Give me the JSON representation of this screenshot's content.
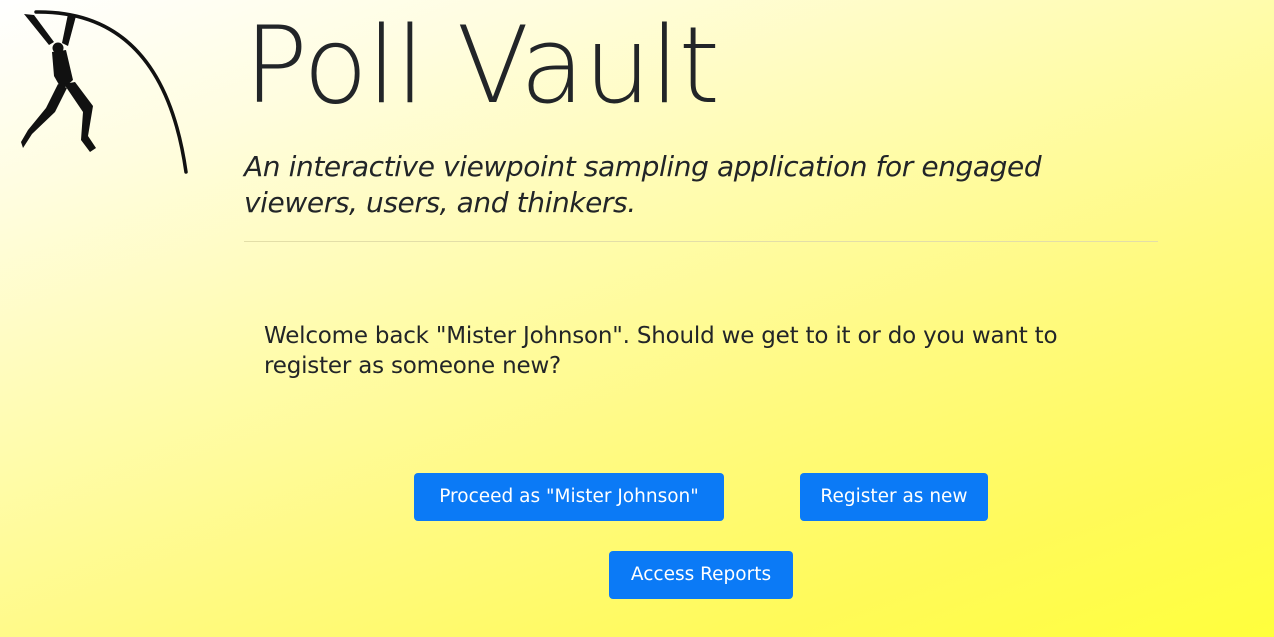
{
  "app": {
    "title": "Poll Vault",
    "tagline": "An interactive viewpoint sampling application for engaged viewers, users, and thinkers.",
    "logo_icon": "pole-vaulter-icon"
  },
  "main": {
    "welcome_message": "Welcome back \"Mister Johnson\". Should we get to it or do you want to register as someone new?",
    "buttons": {
      "proceed_label": "Proceed as \"Mister Johnson\"",
      "register_label": "Register as new",
      "reports_label": "Access Reports"
    }
  },
  "colors": {
    "button_bg": "#0b7af6",
    "button_text": "#ffffff",
    "text": "#222528",
    "background_start": "#ffffff",
    "background_end": "#ffff3c"
  }
}
